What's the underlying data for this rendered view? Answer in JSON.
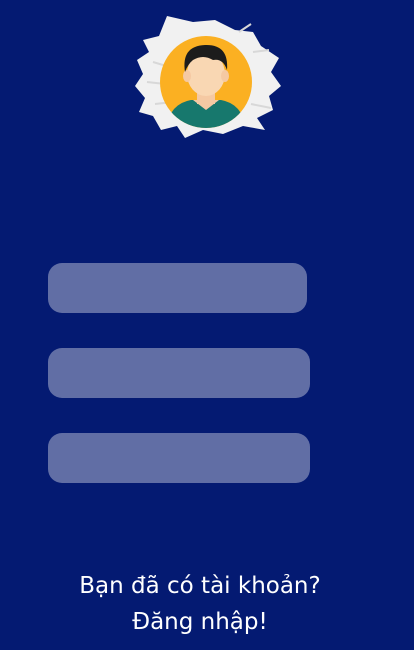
{
  "avatar": {
    "icon": "user-avatar-icon",
    "brush_color": "#f1f1f1",
    "circle_color": "#fbb022"
  },
  "form": {
    "fields": [
      {
        "value": ""
      },
      {
        "value": ""
      },
      {
        "value": ""
      }
    ]
  },
  "footer": {
    "question": "Bạn đã có tài khoản?",
    "login_link": "Đăng nhập!"
  },
  "colors": {
    "background": "#041a72",
    "field": "#616ea5",
    "text": "#ffffff"
  }
}
